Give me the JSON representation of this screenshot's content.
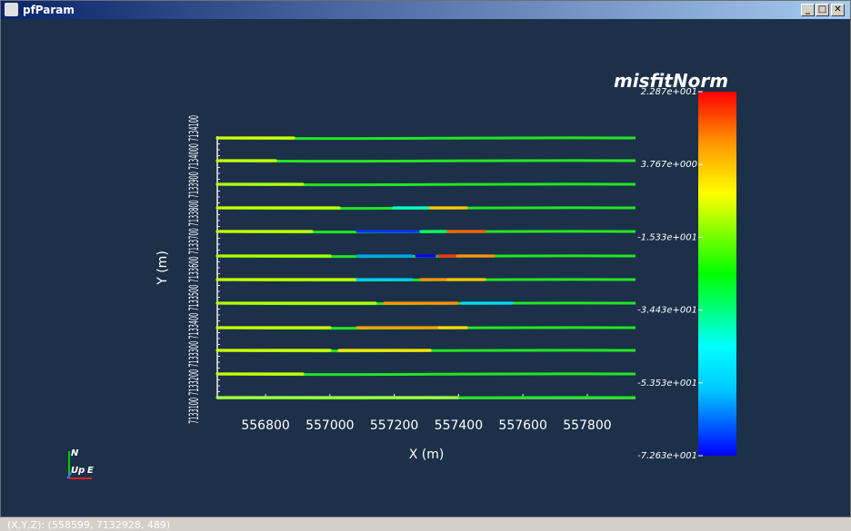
{
  "window": {
    "title": "pfParam",
    "buttons": [
      {
        "name": "minimize",
        "glyph": "_"
      },
      {
        "name": "maximize",
        "glyph": "□"
      },
      {
        "name": "close",
        "glyph": "✕"
      }
    ]
  },
  "chart_data": {
    "type": "line",
    "xlabel": "X (m)",
    "ylabel": "Y (m)",
    "x_ticks": [
      "556800",
      "557000",
      "557200",
      "557400",
      "557600",
      "557800"
    ],
    "x_tick_values": [
      556800,
      557000,
      557200,
      557400,
      557600,
      557800
    ],
    "y_tick_label_text": "7133100 7133200 7133300 7133400 7133500 7133600 7133700 7133800 7133900 7134000 7134100",
    "xlim": [
      556650,
      557950
    ],
    "line_count": 12,
    "colorbar": {
      "title": "misfitNorm",
      "labels": [
        "2.287e+001",
        "3.767e+000",
        "-1.533e+001",
        "-3.443e+001",
        "-5.353e+001",
        "-7.263e+001"
      ],
      "values": [
        22.87,
        3.767,
        -15.33,
        -34.43,
        -53.53,
        -72.63
      ],
      "colormap": [
        "#0000ff",
        "#00ffff",
        "#00ff00",
        "#ffff00",
        "#ff0000"
      ]
    }
  },
  "orientation_axes": {
    "north": "N",
    "up": "Up",
    "east": "E"
  },
  "status": {
    "coords": "(X,Y,Z): (558599, 7132928,    489)"
  }
}
